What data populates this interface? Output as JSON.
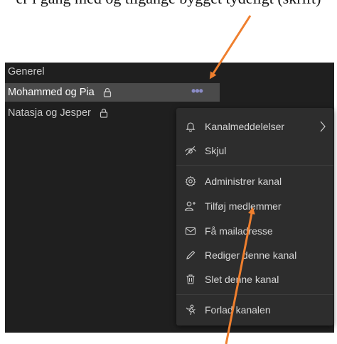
{
  "caption_top": "er i gang med og tilgange bygget tydeligt (skrift)",
  "channels": [
    {
      "name": "Generel"
    },
    {
      "name": "Mohammed og Pia"
    },
    {
      "name": "Natasja og Jesper"
    }
  ],
  "more_button": "•••",
  "menu": {
    "items": [
      {
        "label": "Kanalmeddelelser",
        "icon": "bell-icon"
      },
      {
        "label": "Skjul",
        "icon": "hide-icon"
      },
      {
        "label": "Administrer kanal",
        "icon": "gear-icon"
      },
      {
        "label": "Tilføj medlemmer",
        "icon": "add-person-icon"
      },
      {
        "label": "Få mailadresse",
        "icon": "mail-icon"
      },
      {
        "label": "Rediger denne kanal",
        "icon": "pencil-icon"
      },
      {
        "label": "Slet denne kanal",
        "icon": "trash-icon"
      },
      {
        "label": "Forlad kanalen",
        "icon": "leave-icon"
      }
    ]
  },
  "colors": {
    "panel": "#1f1f1f",
    "menu": "#2d2d2d",
    "selected": "#4a4a4a",
    "accent": "#8b8cc7",
    "arrow": "#ef7f2e"
  }
}
